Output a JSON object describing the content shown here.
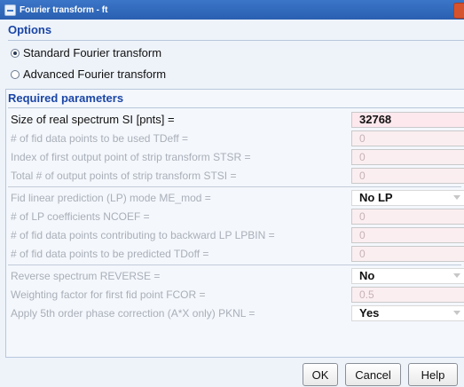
{
  "window": {
    "title": "Fourier transform - ft"
  },
  "options": {
    "header": "Options",
    "choices": [
      {
        "label": "Standard Fourier transform",
        "selected": true
      },
      {
        "label": "Advanced Fourier transform",
        "selected": false
      }
    ]
  },
  "params": {
    "header": "Required parameters",
    "rows": [
      {
        "label": "Size of real spectrum SI [pnts] =",
        "value": "32768",
        "enabled": true,
        "kind": "text"
      },
      {
        "label": "# of fid data points to be used TDeff =",
        "value": "0",
        "enabled": false,
        "kind": "text"
      },
      {
        "label": "Index of first output point of strip transform STSR =",
        "value": "0",
        "enabled": false,
        "kind": "text"
      },
      {
        "label": "Total # of output points of strip transform STSI =",
        "value": "0",
        "enabled": false,
        "kind": "text"
      },
      {
        "label": "Fid linear prediction (LP) mode ME_mod =",
        "value": "No LP",
        "enabled": false,
        "kind": "select"
      },
      {
        "label": "# of LP coefficients NCOEF =",
        "value": "0",
        "enabled": false,
        "kind": "text"
      },
      {
        "label": "# of fid data points contributing to backward LP LPBIN =",
        "value": "0",
        "enabled": false,
        "kind": "text"
      },
      {
        "label": "# of fid data points to be predicted TDoff =",
        "value": "0",
        "enabled": false,
        "kind": "text"
      },
      {
        "label": "Reverse spectrum REVERSE =",
        "value": "No",
        "enabled": false,
        "kind": "select"
      },
      {
        "label": "Weighting factor for first fid point FCOR =",
        "value": "0.5",
        "enabled": false,
        "kind": "text"
      },
      {
        "label": "Apply 5th order phase correction (A*X only) PKNL =",
        "value": "Yes",
        "enabled": false,
        "kind": "select"
      }
    ]
  },
  "buttons": {
    "ok": "OK",
    "cancel": "Cancel",
    "help": "Help"
  }
}
